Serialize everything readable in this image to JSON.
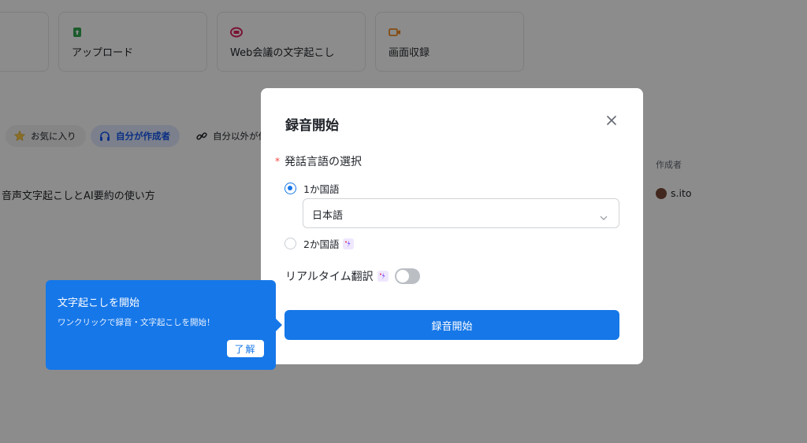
{
  "background": {
    "actions": [
      {
        "label": "",
        "icon": "partial-card"
      },
      {
        "label": "アップロード",
        "icon": "upload-file-icon",
        "color": "#34a853"
      },
      {
        "label": "Web会議の文字起こし",
        "icon": "meeting-icon",
        "color": "#e0245e"
      },
      {
        "label": "画面収録",
        "icon": "screen-record-icon",
        "color": "#f08a24"
      }
    ],
    "filters": [
      {
        "label": "お気に入り",
        "icon": "star-icon"
      },
      {
        "label": "自分が作成者",
        "icon": "headphones-icon",
        "active": true
      },
      {
        "label": "自分以外が作",
        "icon": "link-icon"
      }
    ],
    "table": {
      "author_header": "作成者",
      "rows": [
        {
          "title": "音声文字起こしとAI要約の使い方",
          "author": "s.ito"
        }
      ]
    }
  },
  "modal": {
    "title": "録音開始",
    "required_mark": "*",
    "language_label": "発話言語の選択",
    "options": [
      {
        "label": "1か国語",
        "checked": true
      },
      {
        "label": "2か国語",
        "checked": false,
        "ai": true
      }
    ],
    "selected_language": "日本語",
    "realtime_label": "リアルタイム翻訳",
    "realtime_enabled": false,
    "start_button": "録音開始"
  },
  "tooltip": {
    "title": "文字起こしを開始",
    "text": "ワンクリックで録音・文字起こしを開始！",
    "ok_button": "了解"
  },
  "colors": {
    "primary": "#1677e8",
    "overlay": "rgba(0,0,0,0.45)"
  }
}
